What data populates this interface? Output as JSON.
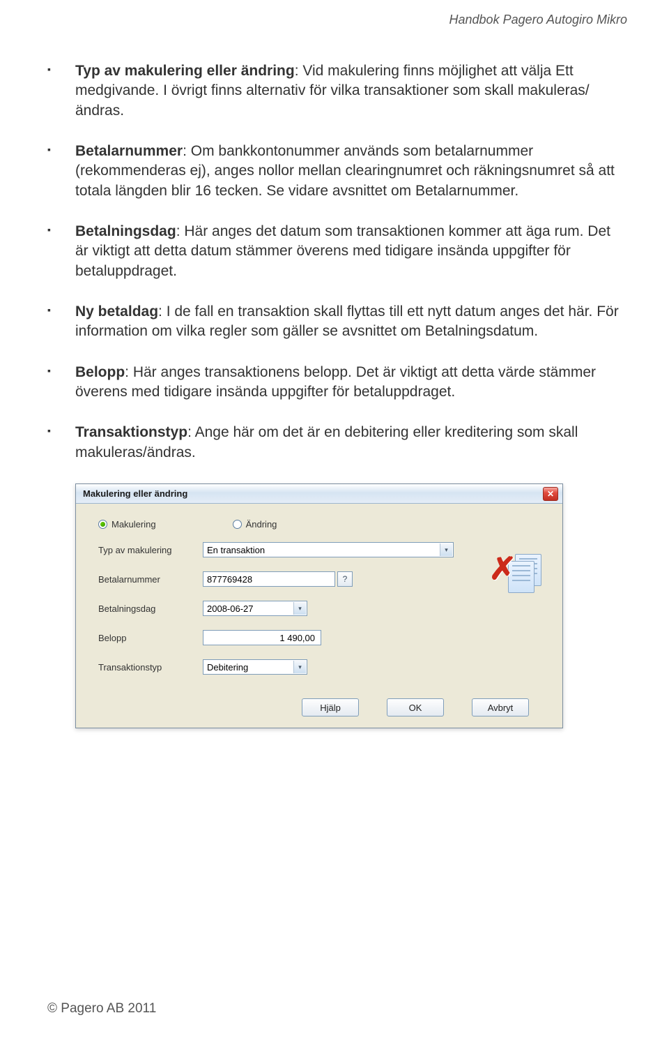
{
  "header": {
    "title": "Handbok Pagero Autogiro Mikro"
  },
  "bullets": [
    {
      "term": "Typ av makulering eller ändring",
      "text": ": Vid makulering finns möjlighet att välja Ett medgivande. I övrigt finns alternativ för vilka transaktioner som skall makuleras/ändras."
    },
    {
      "term": "Betalarnummer",
      "text": ": Om bankkontonummer används som betalarnummer (rekommenderas ej), anges nollor mellan clearingnumret och räkningsnumret så att totala längden blir 16 tecken. Se vidare avsnittet om Betalarnummer."
    },
    {
      "term": "Betalningsdag",
      "text": ": Här anges det datum som transaktionen kommer att äga rum. Det är viktigt att detta datum stämmer överens med tidigare insända uppgifter för betaluppdraget."
    },
    {
      "term": "Ny betaldag",
      "text": ": I de fall en transaktion skall flyttas till ett nytt datum anges det här. För information om vilka regler som gäller se avsnittet om Betalningsdatum."
    },
    {
      "term": "Belopp",
      "text": ": Här anges transaktionens belopp. Det är viktigt att detta värde stämmer överens med tidigare insända uppgifter för betaluppdraget."
    },
    {
      "term": "Transaktionstyp",
      "text": ": Ange här om det är en debitering eller kreditering som skall makuleras/ändras."
    }
  ],
  "dialog": {
    "title": "Makulering eller ändring",
    "radio_makulering": "Makulering",
    "radio_andring": "Ändring",
    "label_typ": "Typ av makulering",
    "value_typ": "En transaktion",
    "label_betalarnummer": "Betalarnummer",
    "value_betalarnummer": "877769428",
    "q_label": "?",
    "label_betalningsdag": "Betalningsdag",
    "value_betalningsdag": "2008-06-27",
    "label_belopp": "Belopp",
    "value_belopp": "1 490,00",
    "label_transtyp": "Transaktionstyp",
    "value_transtyp": "Debitering",
    "btn_help": "Hjälp",
    "btn_ok": "OK",
    "btn_cancel": "Avbryt",
    "close_x": "✕"
  },
  "footer": {
    "copyright": "© Pagero AB 2011"
  }
}
